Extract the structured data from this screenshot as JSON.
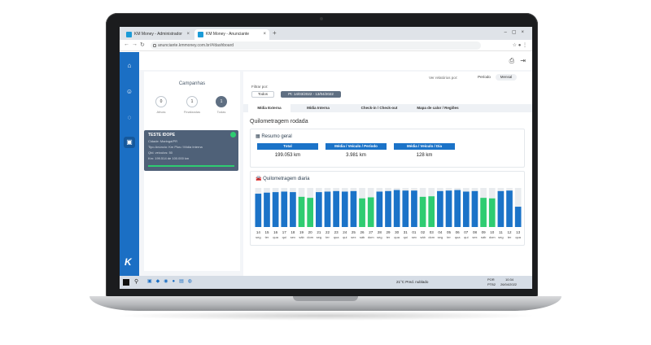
{
  "browser": {
    "tabs": [
      {
        "title": "KM Money - Administrador"
      },
      {
        "title": "KM Money - Anunciante"
      }
    ],
    "url": "anunciante.kmmoney.com.br/#/dashboard"
  },
  "sidebar": {
    "logo": "K"
  },
  "campanhas": {
    "title": "Campanhas",
    "filters": [
      {
        "count": "0",
        "label": "Ativas"
      },
      {
        "count": "1",
        "label": "Finalizadas"
      },
      {
        "count": "1",
        "label": "Todas"
      }
    ],
    "card": {
      "title": "TESTE IDOPE",
      "lines": [
        "Cidade: Maringá/PR",
        "Tipo Anúncio: Km Plus / Mídia Interna",
        "Qtd. veículos: 50",
        "Km: 199.514 de 100.000 km"
      ]
    }
  },
  "main": {
    "ver_relatorios": "Ver relatórios por:",
    "periodo": "Período",
    "mensal": "Mensal",
    "filtrar_por": "Filtrar por:",
    "todos": "Todos",
    "periodo_filter": "Pt: 14/03/2022 - 13/04/2022",
    "tabs": [
      "Mídia Externa",
      "Mídia Interna",
      "Check-in / Check-out",
      "Mapa de calor / Regiões"
    ],
    "section_title": "Quilometragem rodada",
    "resumo": {
      "title": "Resumo geral",
      "stats": [
        {
          "label": "Total",
          "value": "199.053 km"
        },
        {
          "label": "Média / Veículo / Período",
          "value": "3.981 km"
        },
        {
          "label": "Média / Veículo / Dia",
          "value": "128 km"
        }
      ]
    },
    "diaria_title": "Quilometragem diaria"
  },
  "chart_data": {
    "type": "bar",
    "title": "Quilometragem diaria",
    "categories": [
      "14 seg",
      "15 ter",
      "16 qua",
      "17 qui",
      "18 sex",
      "19 sáb",
      "20 dom",
      "21 seg",
      "22 ter",
      "23 qua",
      "24 qui",
      "25 sex",
      "26 sáb",
      "27 dom",
      "28 seg",
      "29 ter",
      "30 qua",
      "31 qui",
      "01 sex",
      "02 sáb",
      "03 dom",
      "04 seg",
      "05 ter",
      "06 qua",
      "07 qui",
      "08 sex",
      "09 sáb",
      "10 dom",
      "11 seg",
      "12 ter",
      "13 qua"
    ],
    "values": [
      6400,
      6600,
      6700,
      6800,
      6700,
      5800,
      5600,
      6700,
      6800,
      6900,
      6800,
      6900,
      5500,
      5700,
      6800,
      6900,
      7100,
      7000,
      7000,
      5800,
      5900,
      6900,
      7000,
      7100,
      6800,
      6900,
      5600,
      5500,
      6900,
      7000,
      3900
    ],
    "weekend_indices": [
      5,
      6,
      12,
      13,
      19,
      20,
      26,
      27
    ],
    "colors": {
      "weekday": "#1b73c8",
      "weekend": "#2ecc71",
      "background": "#e9ecef"
    }
  },
  "taskbar": {
    "weather": "21°C  Pred. nublado",
    "lang": "POR",
    "layout": "PTB2",
    "time": "10:34",
    "date": "26/04/2022"
  }
}
